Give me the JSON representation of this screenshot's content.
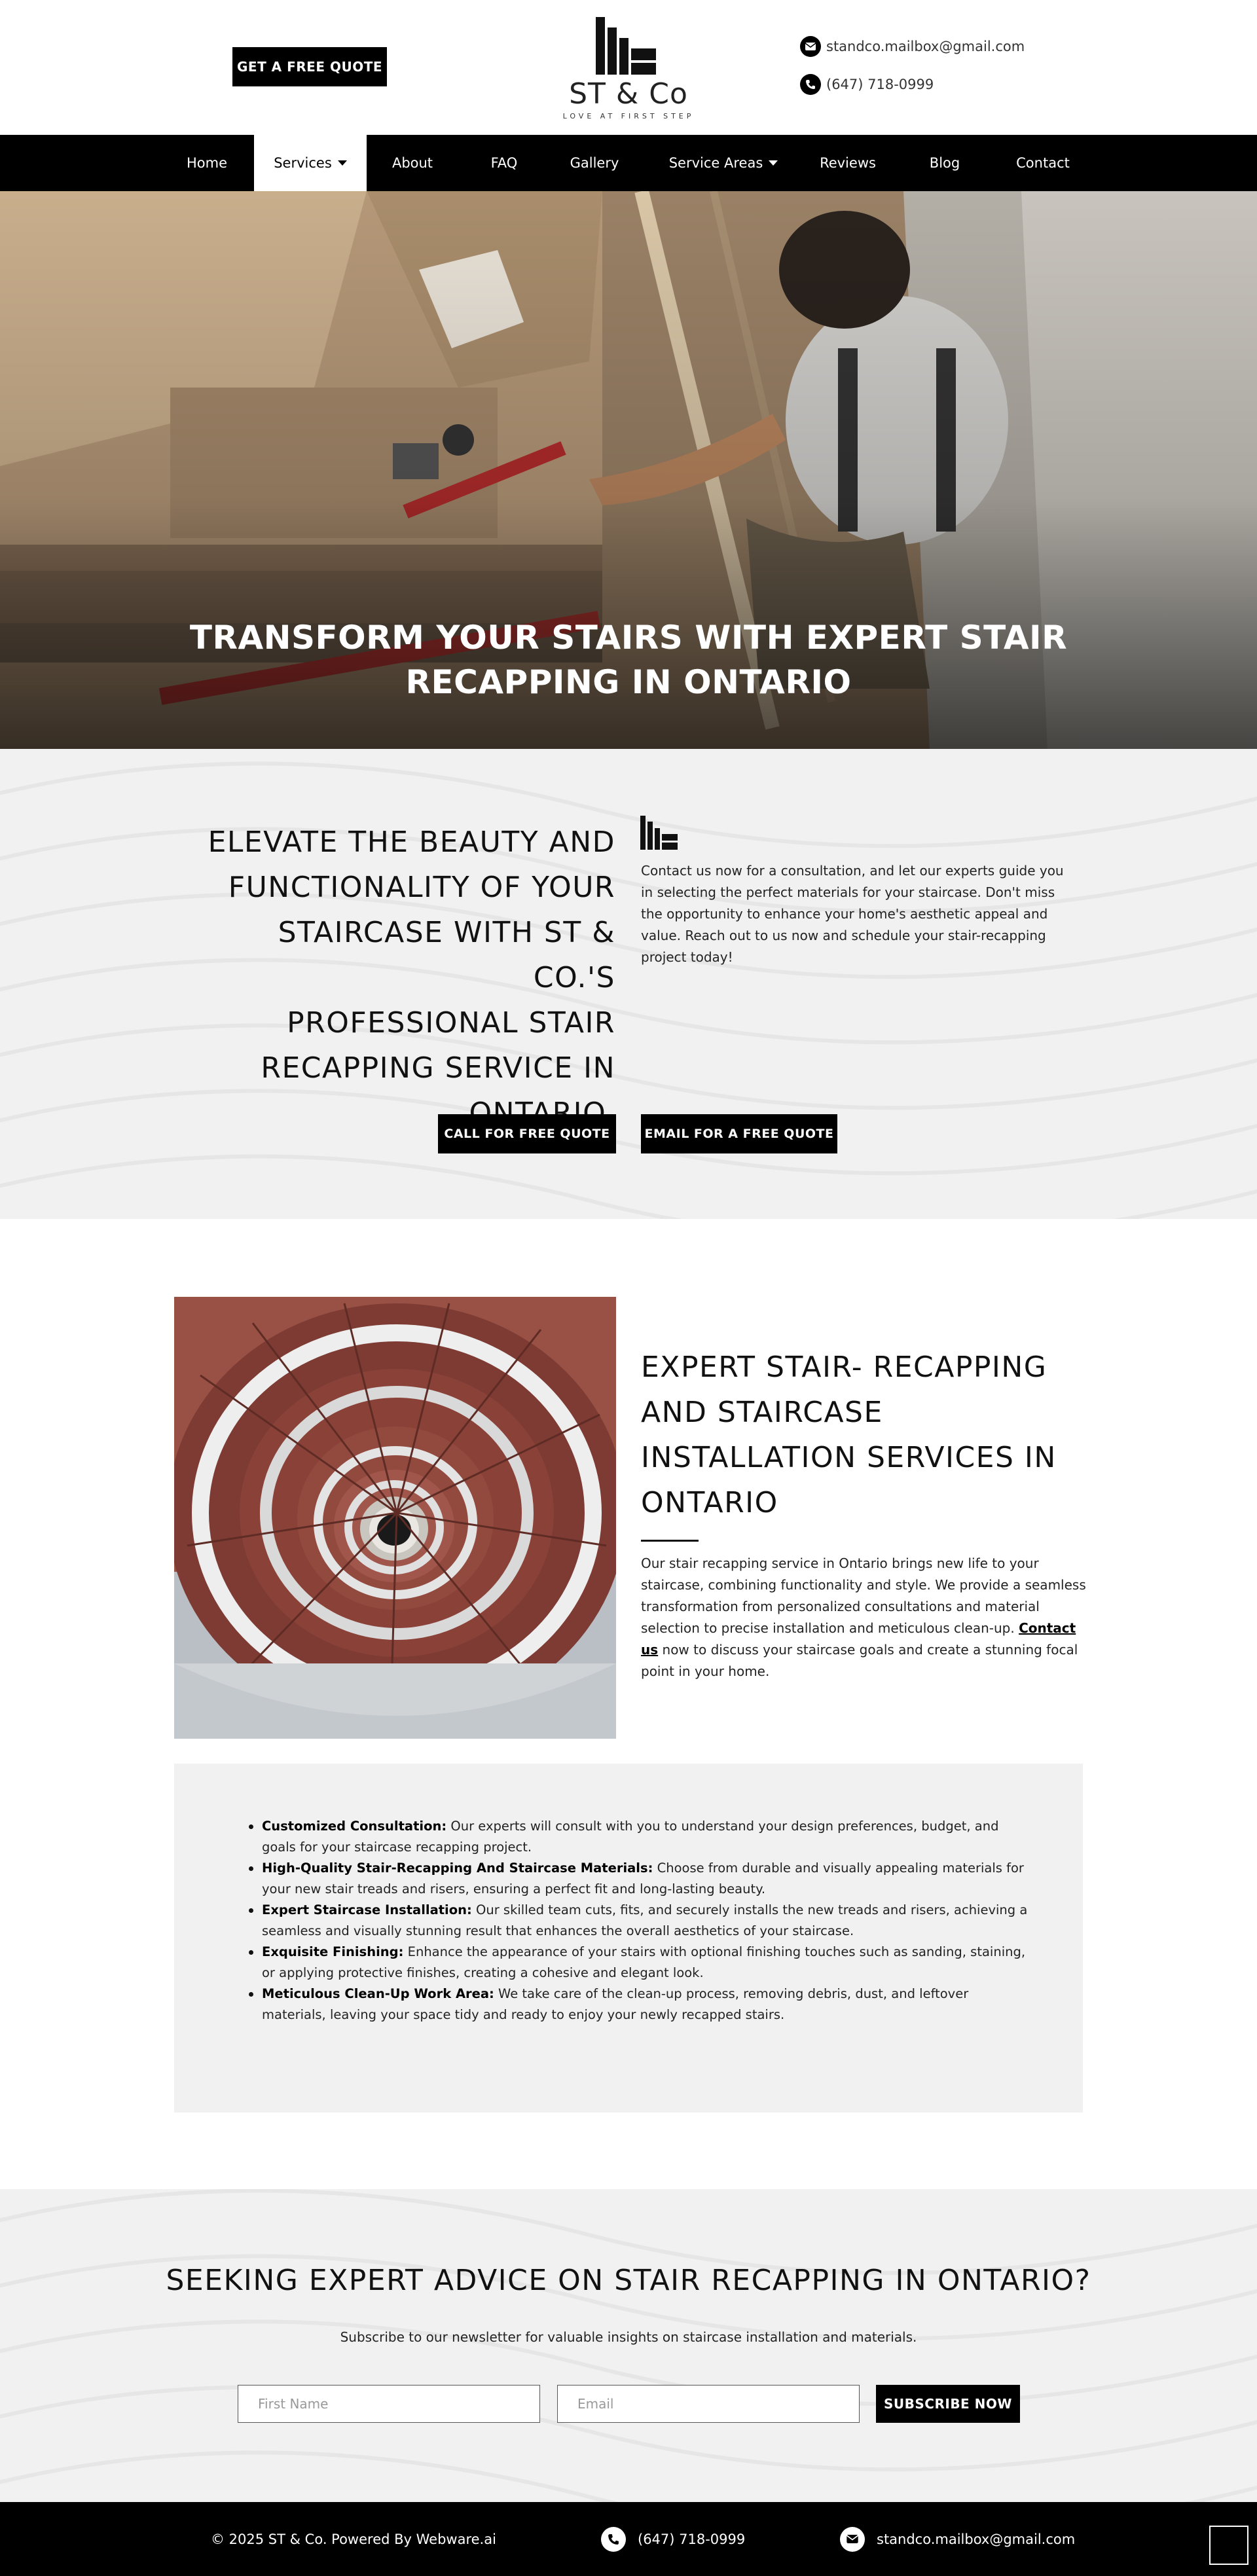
{
  "header": {
    "quote_button": "GET A FREE QUOTE",
    "logo_name": "ST & Co",
    "logo_tagline": "LOVE AT FIRST STEP",
    "email": "standco.mailbox@gmail.com",
    "phone": "(647) 718-0999"
  },
  "nav": {
    "items": [
      {
        "label": "Home"
      },
      {
        "label": "Services",
        "active": true,
        "dropdown": true
      },
      {
        "label": "About"
      },
      {
        "label": "FAQ"
      },
      {
        "label": "Gallery"
      },
      {
        "label": "Service Areas",
        "dropdown": true
      },
      {
        "label": "Reviews"
      },
      {
        "label": "Blog"
      },
      {
        "label": "Contact"
      }
    ]
  },
  "hero": {
    "title_line1": "TRANSFORM YOUR STAIRS WITH EXPERT STAIR",
    "title_line2": "RECAPPING IN ONTARIO"
  },
  "elevate": {
    "heading_lines": [
      "ELEVATE THE BEAUTY AND",
      "FUNCTIONALITY OF YOUR",
      "STAIRCASE WITH ST & CO.'S",
      "PROFESSIONAL STAIR",
      "RECAPPING SERVICE IN",
      "ONTARIO."
    ],
    "text": "Contact us now for a consultation, and let our experts guide you in selecting the perfect materials for your staircase. Don't miss the opportunity to enhance your home's aesthetic appeal and value. Reach out to us now and schedule your stair-recapping project today!",
    "call_button": "CALL FOR FREE QUOTE",
    "email_button": "EMAIL FOR A FREE QUOTE"
  },
  "expert": {
    "heading_lines": [
      "EXPERT STAIR- RECAPPING",
      "AND STAIRCASE",
      "INSTALLATION SERVICES IN",
      "ONTARIO"
    ],
    "text_before": "Our stair recapping service in Ontario brings new life to your staircase, combining functionality and style. We provide a seamless transformation from personalized consultations and material selection to precise installation and meticulous clean-up. ",
    "link": "Contact us",
    "text_after": " now to discuss your staircase goals and create a stunning focal point in your home."
  },
  "features": [
    {
      "title": "Customized Consultation:",
      "text": " Our experts will consult with you to understand your design preferences, budget, and goals for your staircase recapping project."
    },
    {
      "title": "High-Quality Stair-Recapping And Staircase Materials:",
      "text": " Choose from durable and visually appealing materials for your new stair treads and risers, ensuring a perfect fit and long-lasting beauty."
    },
    {
      "title": "Expert Staircase Installation:",
      "text": " Our skilled team cuts, fits, and securely installs the new treads and risers, achieving a seamless and visually stunning result that enhances the overall aesthetics of your staircase."
    },
    {
      "title": "Exquisite Finishing:",
      "text": " Enhance the appearance of your stairs with optional finishing touches such as sanding, staining, or applying protective finishes, creating a cohesive and elegant look."
    },
    {
      "title": "Meticulous Clean-Up Work Area:",
      "text": " We take care of the clean-up process, removing debris, dust, and leftover materials, leaving your space tidy and ready to enjoy your newly recapped stairs."
    }
  ],
  "newsletter": {
    "title": "SEEKING EXPERT ADVICE ON STAIR RECAPPING IN ONTARIO?",
    "subtitle": "Subscribe to our newsletter for valuable insights on staircase installation and materials.",
    "first_name_placeholder": "First Name",
    "email_placeholder": "Email",
    "button": "SUBSCRIBE NOW"
  },
  "footer": {
    "copyright": "© 2025 ST & Co. Powered By Webware.ai",
    "phone": "(647) 718-0999",
    "email": "standco.mailbox@gmail.com"
  },
  "colors": {
    "primary": "#000000",
    "background": "#ffffff",
    "section_gray": "#f1f1f1"
  }
}
